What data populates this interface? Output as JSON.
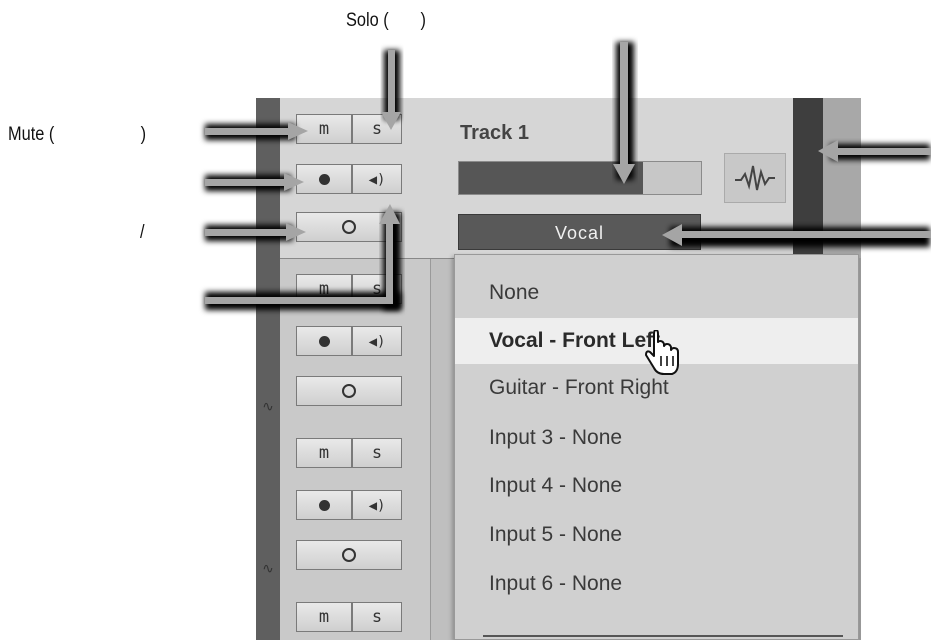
{
  "callouts": {
    "solo": "Solo (       )",
    "mute": "Mute (                   )",
    "slash": "/"
  },
  "track": {
    "name": "Track 1",
    "input_selector": "Vocal",
    "meter_level": 0.76
  },
  "buttons": {
    "mute": "m",
    "solo": "s"
  },
  "menu": {
    "items": [
      {
        "label": "None",
        "selected": false
      },
      {
        "label": "Vocal - Front Left",
        "selected": true
      },
      {
        "label": "Guitar - Front Right",
        "selected": false
      },
      {
        "label": "Input 3 - None",
        "selected": false
      },
      {
        "label": "Input 4 - None",
        "selected": false
      },
      {
        "label": "Input 5 - None",
        "selected": false
      },
      {
        "label": "Input 6 - None",
        "selected": false
      }
    ]
  },
  "icons": {
    "record": "record-icon",
    "monitor": "speaker-icon",
    "input_monitor": "circle-icon",
    "waveform": "waveform-icon",
    "cursor": "hand-pointer-icon",
    "callout_arrow": "arrow-icon"
  }
}
